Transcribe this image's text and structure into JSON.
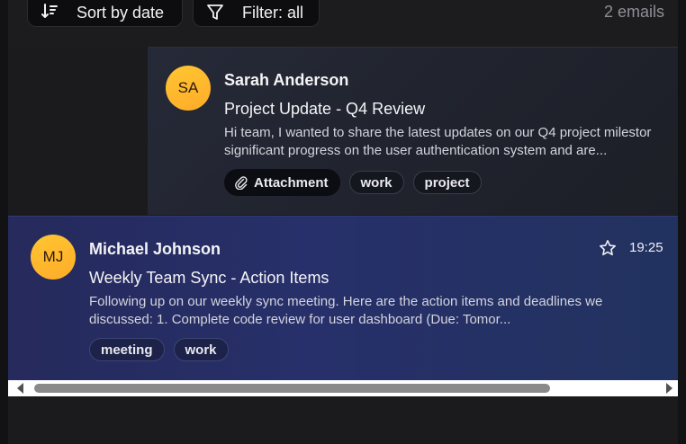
{
  "toolbar": {
    "sort_label": "Sort by date",
    "filter_label": "Filter: all",
    "count_text": "2 emails"
  },
  "emails": [
    {
      "avatar_initials": "SA",
      "sender": "Sarah Anderson",
      "subject": "Project Update - Q4 Review",
      "preview_line1": "Hi team, I wanted to share the latest updates on our Q4 project milestor",
      "preview_line2": "significant progress on the user authentication system and are...",
      "attachment_label": "Attachment",
      "tags": [
        "work",
        "project"
      ]
    },
    {
      "avatar_initials": "MJ",
      "sender": "Michael Johnson",
      "time": "19:25",
      "subject": "Weekly Team Sync - Action Items",
      "preview_line1": "Following up on our weekly sync meeting. Here are the action items and deadlines we",
      "preview_line2": "discussed: 1. Complete code review for user dashboard (Due: Tomor...",
      "tags": [
        "meeting",
        "work"
      ],
      "starred": false
    }
  ],
  "icons": {
    "sort": "sort-descending-icon",
    "filter": "filter-funnel-icon",
    "attachment": "paperclip-icon",
    "star": "star-outline-icon"
  },
  "colors": {
    "avatar": "#ffb92e",
    "selected_card": "#27306a",
    "background": "#1b1b1e"
  }
}
